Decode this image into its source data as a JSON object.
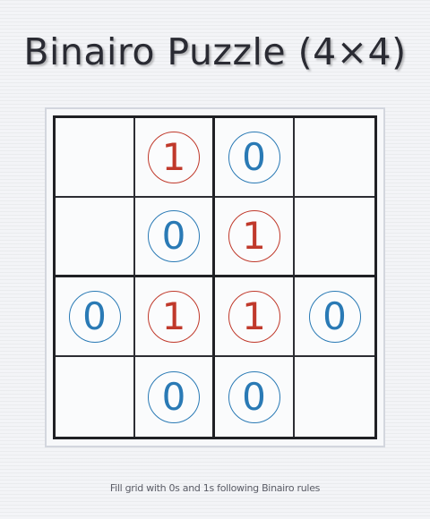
{
  "title": "Binairo Puzzle (4×4)",
  "footer": "Fill grid with 0s and 1s following Binairo rules",
  "colors": {
    "one": "#c0392b",
    "zero": "#2a7ab5"
  },
  "grid": [
    [
      "",
      "1",
      "0",
      ""
    ],
    [
      "",
      "0",
      "1",
      ""
    ],
    [
      "0",
      "1",
      "1",
      "0"
    ],
    [
      "",
      "0",
      "0",
      ""
    ]
  ]
}
